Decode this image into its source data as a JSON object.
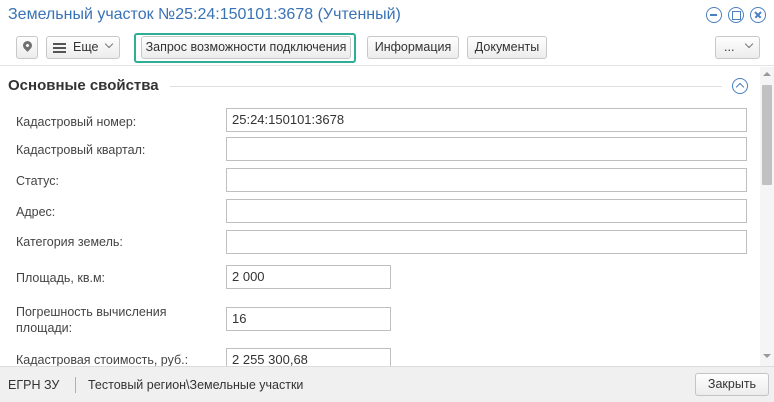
{
  "window": {
    "title": "Земельный участок №25:24:150101:3678 (Учтенный)"
  },
  "toolbar": {
    "more_label": "Еще",
    "request_label": "Запрос возможности подключения",
    "info_label": "Информация",
    "docs_label": "Документы",
    "ellipsis_label": "..."
  },
  "section": {
    "title": "Основные свойства"
  },
  "fields": [
    {
      "label": "Кадастровый номер:",
      "value": ""
    },
    {
      "label": "Кадастровый квартал:",
      "value": ""
    },
    {
      "label": "Статус:",
      "value": ""
    },
    {
      "label": "Адрес:",
      "value": ""
    },
    {
      "label": "Категория земель:",
      "value": ""
    },
    {
      "label": "Площадь, кв.м:",
      "value": "2 000"
    },
    {
      "label": "Погрешность вычисления площади:",
      "value": "16"
    },
    {
      "label": "Кадастровая стоимость, руб.:",
      "value": "2 255 300,68"
    }
  ],
  "cadastral_number_value": "25:24:150101:3678",
  "statusbar": {
    "source": "ЕГРН ЗУ",
    "path": "Тестовый регион\\Земельные участки",
    "close_label": "Закрыть"
  },
  "colors": {
    "title_blue": "#3a72b6",
    "highlight_green": "#2eae95"
  },
  "icons": {
    "pin": "map-pin-icon",
    "menu": "hamburger-menu-icon",
    "collapse": "chevron-up-circle-icon",
    "minimize": "minimize-icon",
    "restore": "restore-icon",
    "close": "close-icon"
  }
}
